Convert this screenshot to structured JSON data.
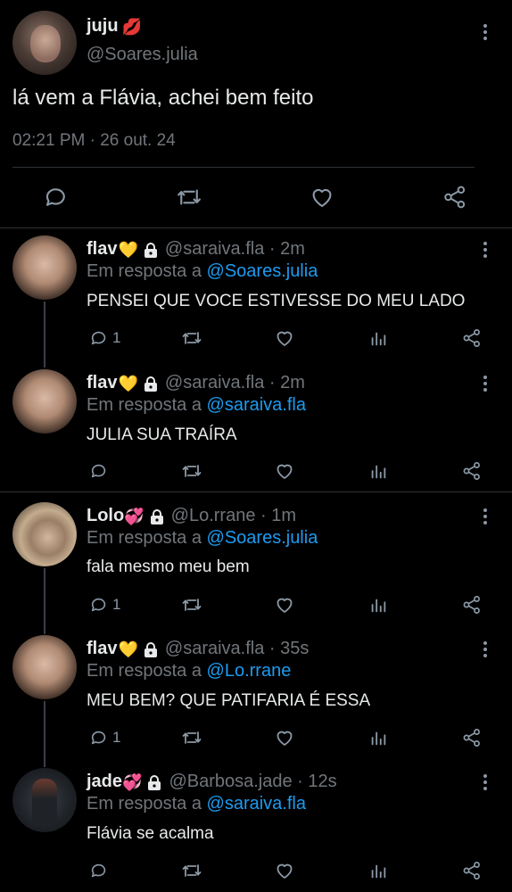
{
  "main": {
    "name": "juju",
    "name_emoji": "💋",
    "handle": "@Soares.julia",
    "text": "lá vem a Flávia, achei bem feito",
    "timestamp": "02:21 PM · 26 out. 24"
  },
  "replies": [
    {
      "name": "flav",
      "emoji": "💛",
      "handle_time": "@saraiva.fla · 2m",
      "reply_prefix": "Em resposta a",
      "reply_to": "@Soares.julia",
      "text": "PENSEI QUE VOCE ESTIVESSE DO MEU LADO",
      "reply_count": "1"
    },
    {
      "name": "flav",
      "emoji": "💛",
      "handle_time": "@saraiva.fla · 2m",
      "reply_prefix": "Em resposta a",
      "reply_to": "@saraiva.fla",
      "text": "JULIA SUA TRAÍRA",
      "reply_count": ""
    },
    {
      "name": "Lolo",
      "emoji": "💞",
      "handle_time": "@Lo.rrane · 1m",
      "reply_prefix": "Em resposta a",
      "reply_to": "@Soares.julia",
      "text": "fala mesmo meu bem",
      "reply_count": "1"
    },
    {
      "name": "flav",
      "emoji": "💛",
      "handle_time": "@saraiva.fla · 35s",
      "reply_prefix": "Em resposta a",
      "reply_to": "@Lo.rrane",
      "text": "MEU BEM? QUE PATIFARIA É ESSA",
      "reply_count": "1"
    },
    {
      "name": "jade",
      "emoji": "💞",
      "handle_time": "@Barbosa.jade · 12s",
      "reply_prefix": "Em resposta a",
      "reply_to": "@saraiva.fla",
      "text": "Flávia se acalma",
      "reply_count": ""
    }
  ],
  "colors": {
    "background": "#000000",
    "text": "#e7e9ea",
    "muted": "#71767b",
    "mention": "#1d9bf0",
    "divider": "#2f3336"
  },
  "icons": [
    "more-icon",
    "reply-icon",
    "retweet-icon",
    "like-icon",
    "views-icon",
    "share-icon",
    "lock-icon"
  ]
}
